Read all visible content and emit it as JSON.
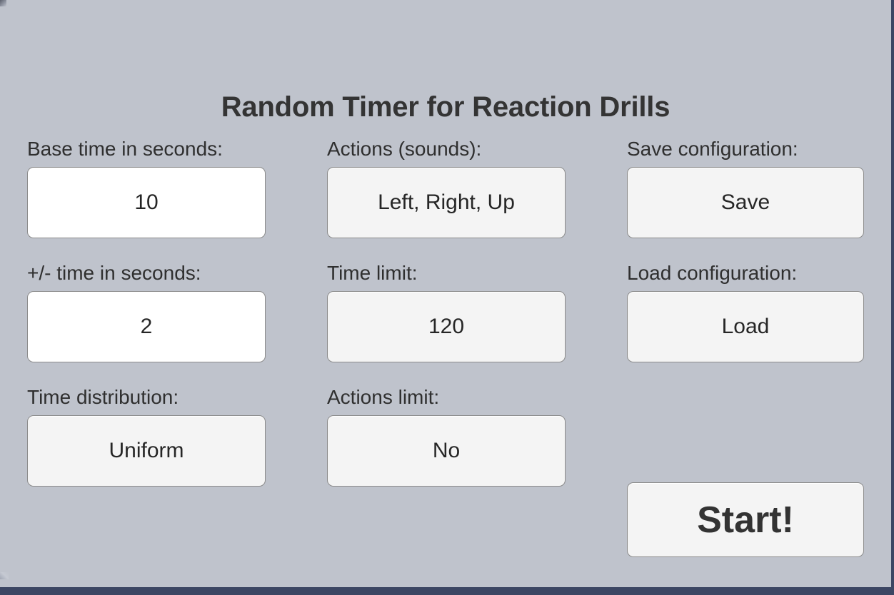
{
  "window": {
    "title": "Random Timer for Reaction Drills",
    "background_color": "#bfc3cc",
    "frame_color": "#3c4663",
    "input_background": "#ffffff",
    "button_background": "#f4f4f4",
    "border_color": "#8b8b8b",
    "text_color": "#2f2f2f"
  },
  "columns": {
    "left": [
      {
        "label": "Base time in seconds:",
        "value": "10",
        "kind": "text-input"
      },
      {
        "label": "+/- time in seconds:",
        "value": "2",
        "kind": "text-input"
      },
      {
        "label": "Time distribution:",
        "value": "Uniform",
        "kind": "button"
      }
    ],
    "middle": [
      {
        "label": "Actions (sounds):",
        "value": "Left, Right, Up",
        "kind": "button"
      },
      {
        "label": "Time limit:",
        "value": "120",
        "kind": "button"
      },
      {
        "label": "Actions limit:",
        "value": "No",
        "kind": "button"
      }
    ],
    "right": [
      {
        "label": "Save configuration:",
        "value": "Save",
        "kind": "button"
      },
      {
        "label": "Load configuration:",
        "value": "Load",
        "kind": "button"
      }
    ]
  },
  "start": {
    "label": "Start!"
  }
}
